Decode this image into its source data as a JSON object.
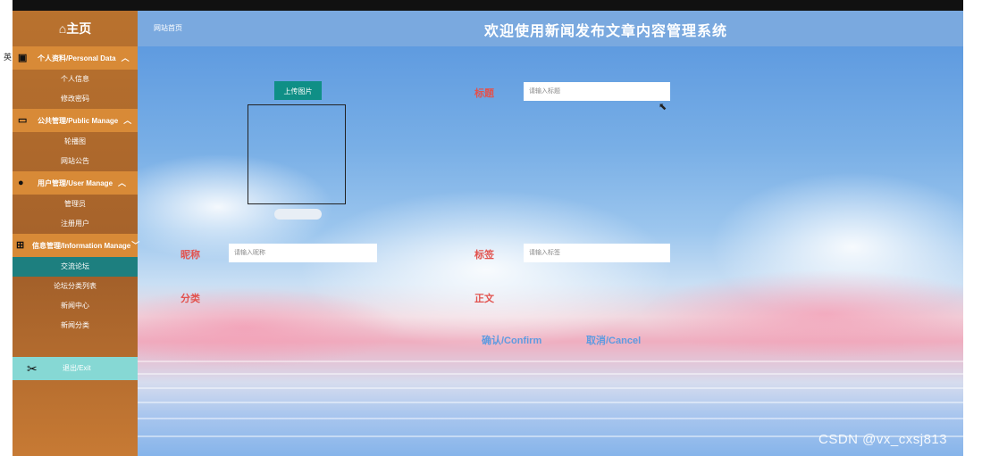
{
  "header": {
    "home": "⌂主页",
    "breadcrumb": "网站首页",
    "title": "欢迎使用新闻发布文章内容管理系统"
  },
  "sidebar": {
    "groups": [
      {
        "label": "个人资料/Personal Data",
        "icon": "user-card-icon",
        "items": [
          "个人信息",
          "修改密码"
        ]
      },
      {
        "label": "公共管理/Public Manage",
        "icon": "monitor-icon",
        "items": [
          "轮播图",
          "网站公告"
        ]
      },
      {
        "label": "用户管理/User Manage",
        "icon": "user-gear-icon",
        "items": [
          "管理员",
          "注册用户"
        ]
      },
      {
        "label": "信息管理/Information Manage",
        "icon": "hierarchy-icon",
        "items": [
          "交流论坛",
          "论坛分类列表",
          "新闻中心",
          "新闻分类"
        ]
      }
    ],
    "active_item": "交流论坛",
    "logout": "退出/Exit",
    "side_glyph": "英"
  },
  "form": {
    "upload_button": "上传图片",
    "title_label": "标题",
    "title_placeholder": "请输入标题",
    "nickname_label": "昵称",
    "nickname_placeholder": "请输入昵称",
    "tag_label": "标签",
    "tag_placeholder": "请输入标签",
    "category_label": "分类",
    "body_label": "正文",
    "confirm": "确认/Confirm",
    "cancel": "取消/Cancel"
  },
  "watermark": "CSDN @vx_cxsj813",
  "colors": {
    "sidebar": "#a3602a",
    "group_header": "#d88a37",
    "active": "#1d7f7f",
    "logout": "#86d8d4",
    "label": "#e2524e",
    "button": "#0f8f86"
  }
}
